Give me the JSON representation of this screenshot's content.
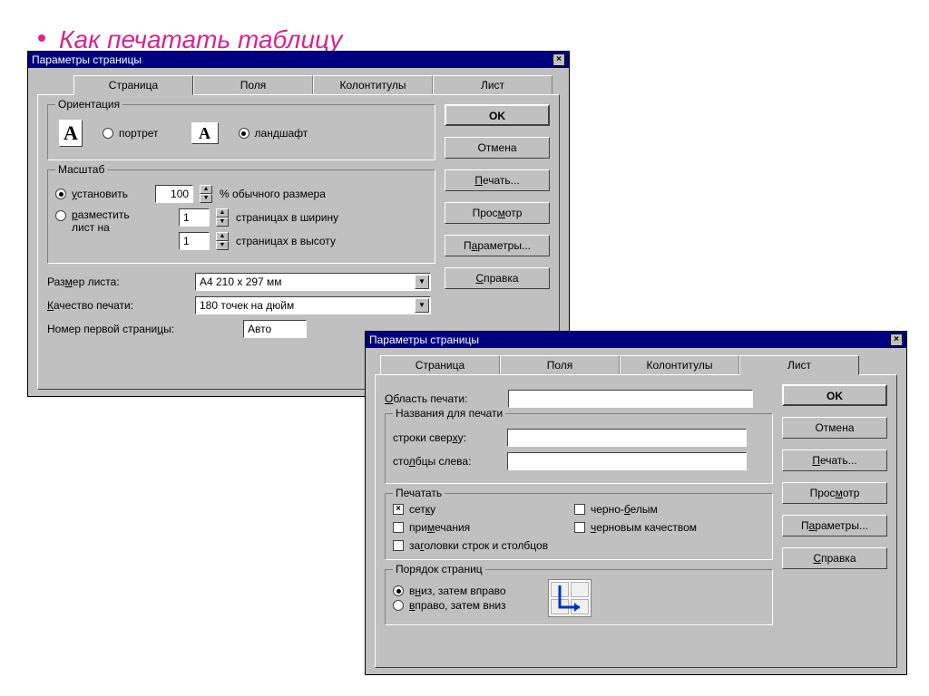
{
  "slide_title": "Как печатать таблицу",
  "dlg1": {
    "title": "Параметры страницы",
    "tabs": [
      "Страница",
      "Поля",
      "Колонтитулы",
      "Лист"
    ],
    "active_tab": 0,
    "orientation": {
      "legend": "Ориентация",
      "portrait": "портрет",
      "landscape": "ландшафт",
      "selected": "landscape",
      "glyph_portrait": "A",
      "glyph_landscape": "A"
    },
    "scale": {
      "legend": "Масштаб",
      "set_label": "установить",
      "set_value": "100",
      "set_suffix": "% обычного размера",
      "fit_label": "разместить лист на",
      "fit_wide": "1",
      "fit_wide_suffix": "страницах в ширину",
      "fit_tall": "1",
      "fit_tall_suffix": "страницах в высоту",
      "selected": "set"
    },
    "paper_label": "Размер листа:",
    "paper_value": "A4 210 x 297 мм",
    "quality_label": "Качество печати:",
    "quality_value": "180 точек на дюйм",
    "firstpage_label": "Номер первой страницы:",
    "firstpage_value": "Авто",
    "buttons": {
      "ok": "OK",
      "cancel": "Отмена",
      "print": "Печать...",
      "preview": "Просмотр",
      "options": "Параметры...",
      "help": "Справка"
    }
  },
  "dlg2": {
    "title": "Параметры страницы",
    "tabs": [
      "Страница",
      "Поля",
      "Колонтитулы",
      "Лист"
    ],
    "active_tab": 3,
    "print_area_label": "Область печати:",
    "print_area_value": "",
    "titles": {
      "legend": "Названия для печати",
      "rows_label": "строки сверху:",
      "rows_value": "",
      "cols_label": "столбцы слева:",
      "cols_value": ""
    },
    "print_opts": {
      "legend": "Печатать",
      "grid": "сетку",
      "grid_checked": true,
      "bw": "черно-белым",
      "bw_checked": false,
      "notes": "примечания",
      "notes_checked": false,
      "draft": "черновым качеством",
      "draft_checked": false,
      "headings": "заголовки строк и столбцов",
      "headings_checked": false
    },
    "page_order": {
      "legend": "Порядок страниц",
      "down": "вниз, затем вправо",
      "over": "вправо, затем вниз",
      "selected": "down"
    },
    "buttons": {
      "ok": "OK",
      "cancel": "Отмена",
      "print": "Печать...",
      "preview": "Просмотр",
      "options": "Параметры...",
      "help": "Справка"
    }
  }
}
